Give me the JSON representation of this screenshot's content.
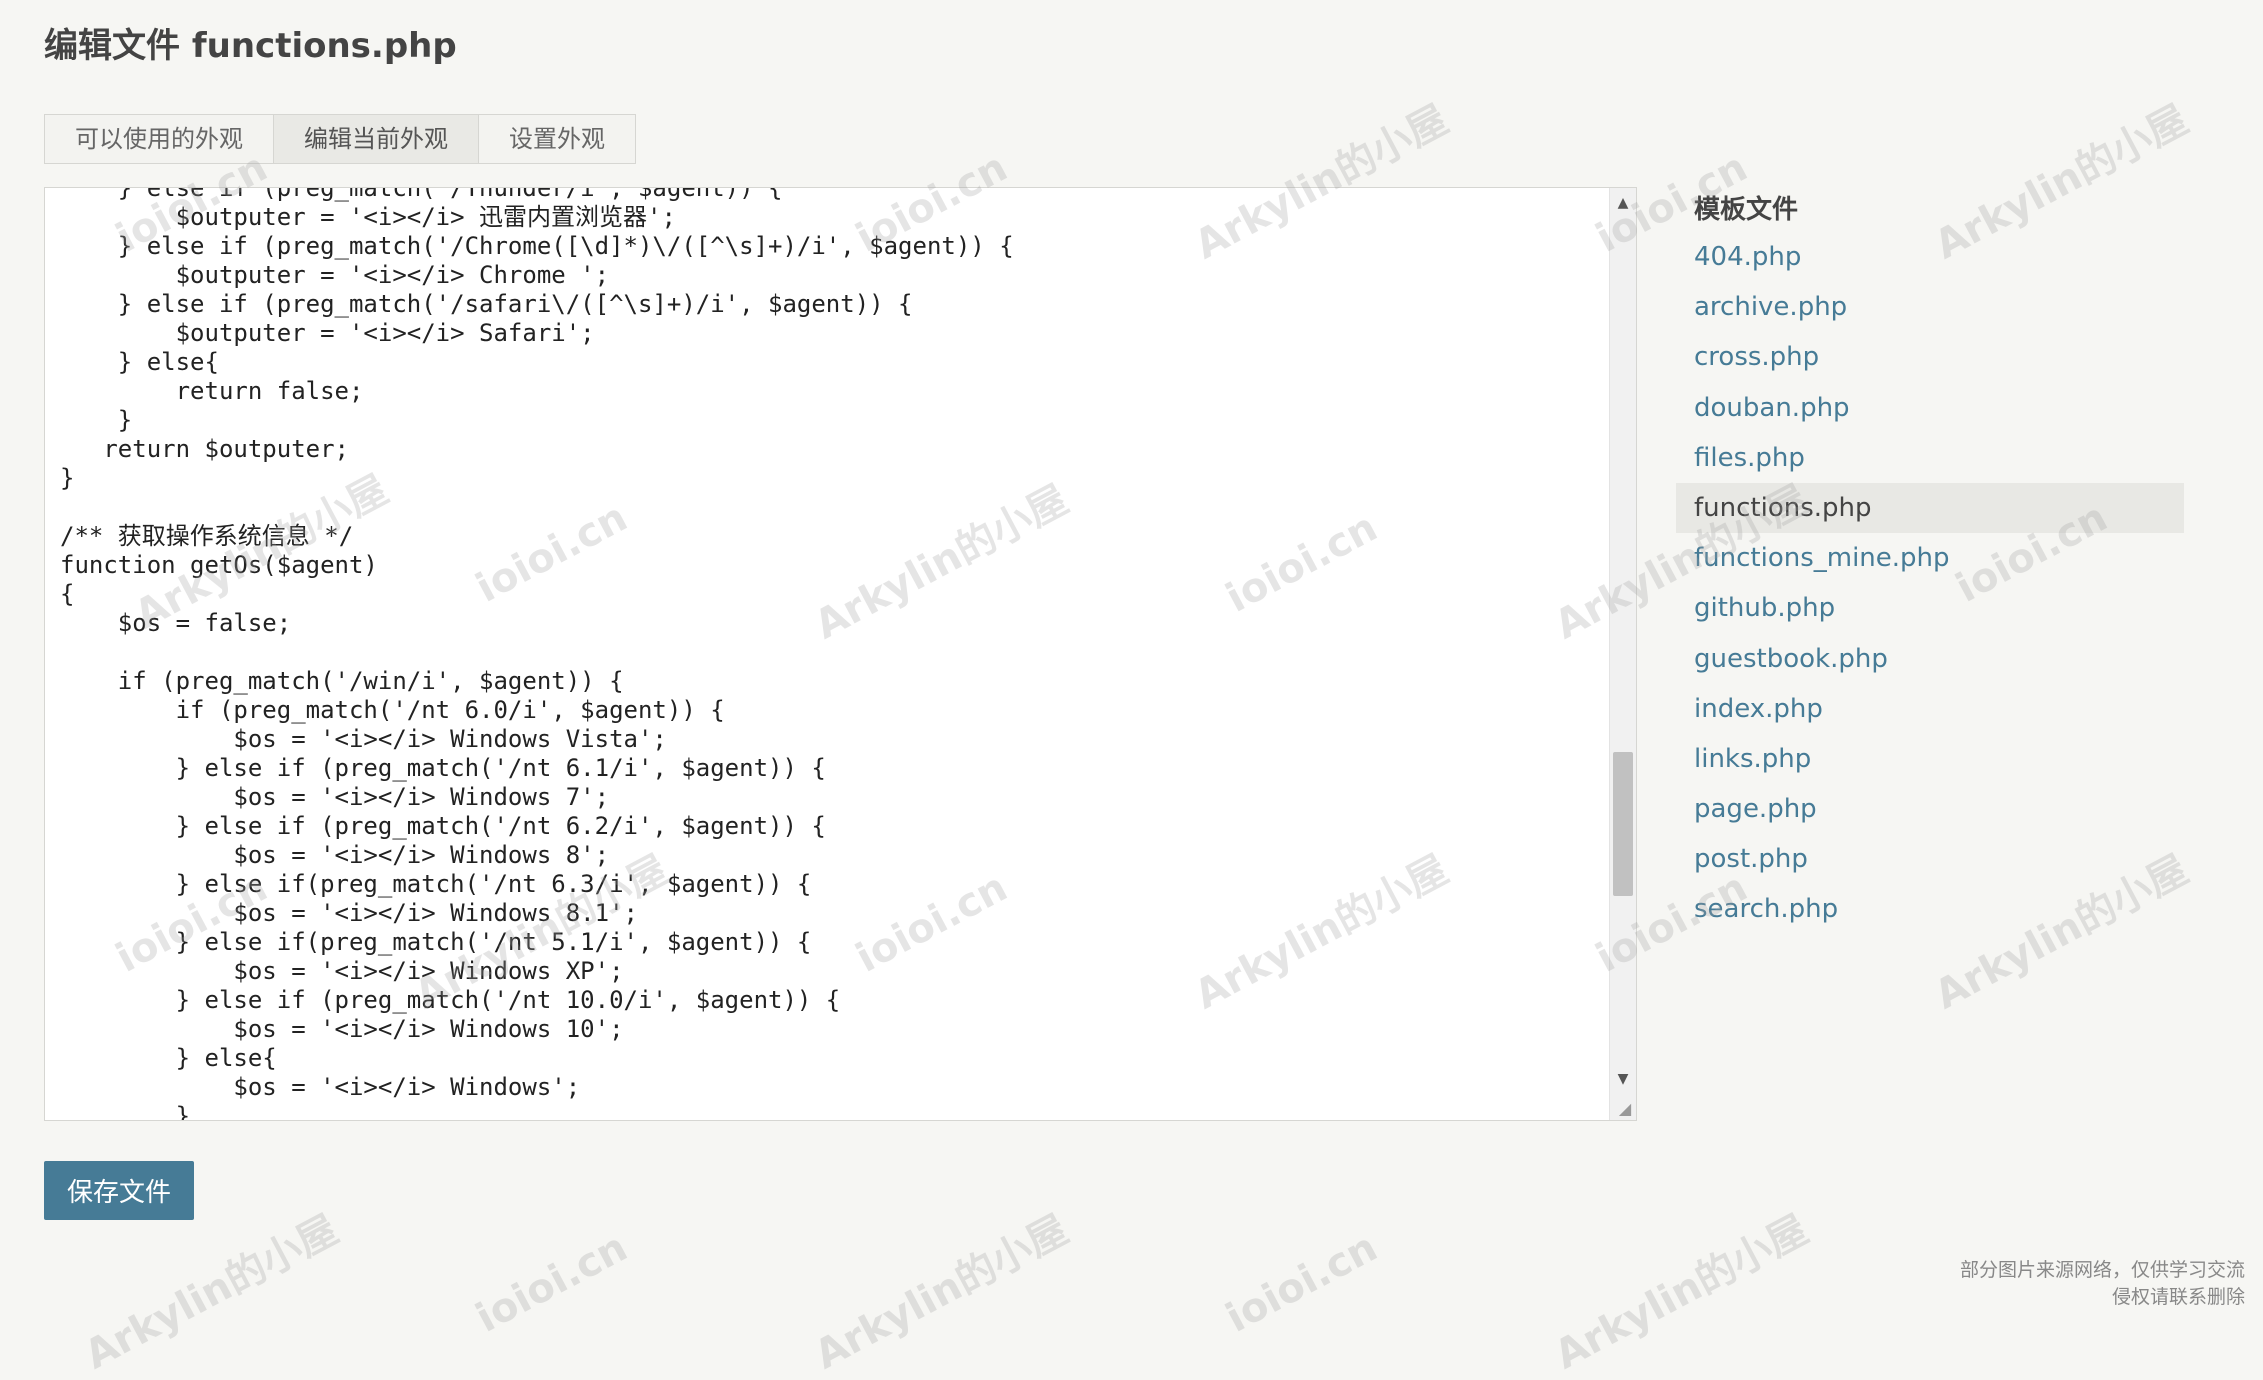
{
  "page": {
    "title": "编辑文件 functions.php"
  },
  "tabs": [
    {
      "label": "可以使用的外观",
      "active": false
    },
    {
      "label": "编辑当前外观",
      "active": true
    },
    {
      "label": "设置外观",
      "active": false
    }
  ],
  "editor": {
    "code_lines": [
      "    } else if (preg_match('/Thunder/i', $agent)) {",
      "        $outputer = '<i></i> 迅雷内置浏览器';",
      "    } else if (preg_match('/Chrome([\\d]*)\\/([^\\s]+)/i', $agent)) {",
      "        $outputer = '<i></i> Chrome ';",
      "    } else if (preg_match('/safari\\/([^\\s]+)/i', $agent)) {",
      "        $outputer = '<i></i> Safari';",
      "    } else{",
      "        return false;",
      "    }",
      "   return $outputer;",
      "}",
      "",
      "/** 获取操作系统信息 */",
      "function getOs($agent)",
      "{",
      "    $os = false;",
      "",
      "    if (preg_match('/win/i', $agent)) {",
      "        if (preg_match('/nt 6.0/i', $agent)) {",
      "            $os = '<i></i> Windows Vista';",
      "        } else if (preg_match('/nt 6.1/i', $agent)) {",
      "            $os = '<i></i> Windows 7';",
      "        } else if (preg_match('/nt 6.2/i', $agent)) {",
      "            $os = '<i></i> Windows 8';",
      "        } else if(preg_match('/nt 6.3/i', $agent)) {",
      "            $os = '<i></i> Windows 8.1';",
      "        } else if(preg_match('/nt 5.1/i', $agent)) {",
      "            $os = '<i></i> Windows XP';",
      "        } else if (preg_match('/nt 10.0/i', $agent)) {",
      "            $os = '<i></i> Windows 10';",
      "        } else{",
      "            $os = '<i></i> Windows';",
      "        }"
    ]
  },
  "save_button": {
    "label": "保存文件"
  },
  "sidebar": {
    "title": "模板文件",
    "files": [
      "404.php",
      "archive.php",
      "cross.php",
      "douban.php",
      "files.php",
      "functions.php",
      "functions_mine.php",
      "github.php",
      "guestbook.php",
      "index.php",
      "links.php",
      "page.php",
      "post.php",
      "search.php"
    ],
    "current": "functions.php"
  },
  "notice": {
    "line1": "部分图片来源网络，仅供学习交流",
    "line2": "侵权请联系删除"
  },
  "watermarks": [
    "Arkylin的小屋",
    "ioioi.cn"
  ],
  "colors": {
    "accent": "#467b96",
    "background": "#f6f6f3",
    "selected_item": "#e8e8e4"
  }
}
